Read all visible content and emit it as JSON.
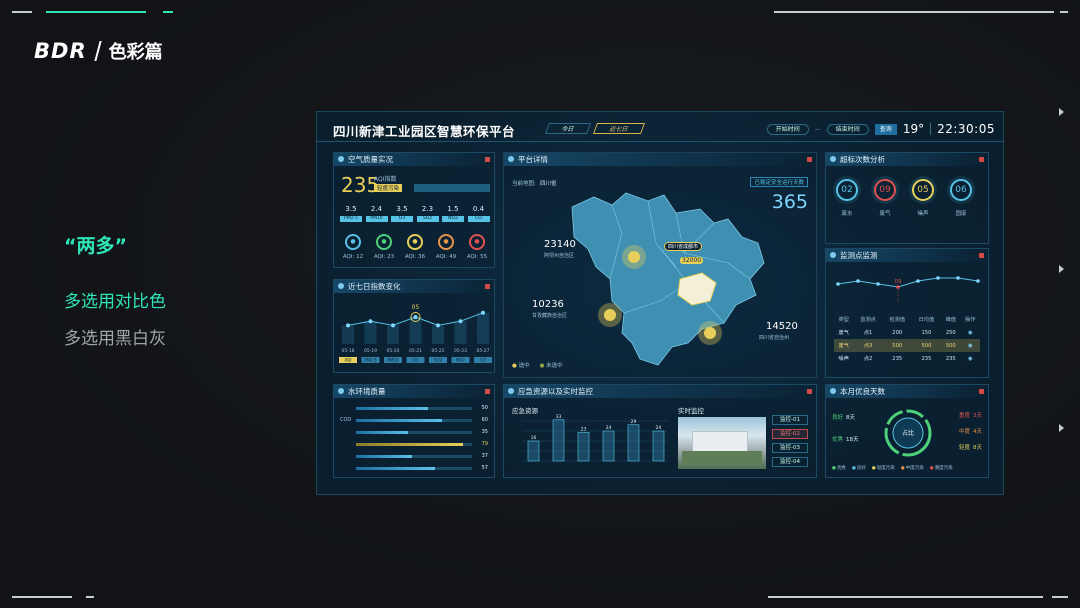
{
  "brand": {
    "logo": "BDR",
    "subtitle": "色彩篇"
  },
  "slide": {
    "quote": "“两多”",
    "point1": "多选用对比色",
    "point2": "多选用黑白灰"
  },
  "dashboard": {
    "title": "四川新津工业园区智慧环保平台",
    "tabs": [
      "今日",
      "近七日"
    ],
    "start_label": "开始时间",
    "end_label": "结束时间",
    "query_label": "查询",
    "temperature": "19°",
    "time": "22:30:05",
    "air": {
      "title": "空气质量实况",
      "aqi": "235",
      "aqi_label": "AQI指数",
      "level": "轻度污染",
      "readings": [
        {
          "v": "3.5",
          "n": "PM2.5"
        },
        {
          "v": "2.4",
          "n": "PM10"
        },
        {
          "v": "3.5",
          "n": "O3"
        },
        {
          "v": "2.3",
          "n": "SO2"
        },
        {
          "v": "1.5",
          "n": "NO2"
        },
        {
          "v": "0.4",
          "n": "CO"
        }
      ],
      "icons": [
        {
          "c": "#5bc0ea",
          "a": "AQI: 12"
        },
        {
          "c": "#4fd07a",
          "a": "AQI: 23"
        },
        {
          "c": "#e8cf5a",
          "a": "AQI: 36"
        },
        {
          "c": "#e8924a",
          "a": "AQI: 49"
        },
        {
          "c": "#e05252",
          "a": "AQI: 55"
        }
      ]
    },
    "seven": {
      "title": "近七日指数变化",
      "peak": "05",
      "dates": [
        "05-18",
        "05-19",
        "05-20",
        "05-21",
        "05-22",
        "05-23",
        "05-27"
      ],
      "values": [
        3,
        4,
        3,
        5,
        3,
        4,
        6
      ],
      "tags": [
        "AQI",
        "PM2.5",
        "PM10",
        "O3",
        "SO2",
        "NO2",
        "CO"
      ]
    },
    "water": {
      "title": "水环境质量",
      "rows": [
        {
          "l": "",
          "v": "50",
          "p": 0.62
        },
        {
          "l": "COD",
          "v": "60",
          "p": 0.74
        },
        {
          "l": "",
          "v": "35",
          "p": 0.45
        },
        {
          "l": "",
          "v": "79",
          "p": 0.92,
          "hl": true
        },
        {
          "l": "",
          "v": "37",
          "p": 0.48
        },
        {
          "l": "",
          "v": "57",
          "p": 0.68
        }
      ]
    },
    "map": {
      "title": "平台详情",
      "area_prefix": "当前地图:",
      "area": "四川省",
      "run_days_label": "已稳定安全运行天数",
      "run_days": "365",
      "labels": [
        {
          "v": "23140",
          "n": "阿坝州自治区"
        },
        {
          "v": "10236",
          "n": "甘孜藏族自治区"
        },
        {
          "v": "14520",
          "n": "四川省自治州"
        },
        {
          "v": "32000",
          "n": "四川省成都市"
        }
      ],
      "legend": [
        "选中",
        "未选中"
      ]
    },
    "emergency": {
      "title": "应急资源以及实时监控",
      "sub1": "应急资源",
      "sub2": "实时监控",
      "bars": [
        16,
        33,
        23,
        24,
        29,
        24
      ],
      "monitors": [
        "监控-01",
        "监控-02",
        "监控-03",
        "监控-04"
      ]
    },
    "exceed": {
      "title": "超标次数分析",
      "items": [
        {
          "v": "02",
          "n": "废水",
          "c": "#56c3e6"
        },
        {
          "v": "09",
          "n": "废气",
          "c": "#e05252"
        },
        {
          "v": "05",
          "n": "噪声",
          "c": "#e8cf5a"
        },
        {
          "v": "06",
          "n": "固废",
          "c": "#56c3e6"
        }
      ]
    },
    "monitor": {
      "title": "监测点监测",
      "peak": "09",
      "values": [
        5,
        6,
        5,
        4,
        6,
        7,
        7,
        6
      ],
      "cols": [
        "类型",
        "监测点",
        "检测值",
        "日均值",
        "峰值",
        "操作"
      ],
      "rows": [
        [
          "废气",
          "点1",
          "200",
          "150",
          "250"
        ],
        [
          "废气",
          "点3",
          "500",
          "500",
          "500"
        ],
        [
          "噪声",
          "点2",
          "235",
          "235",
          "235"
        ]
      ]
    },
    "good": {
      "title": "本月优良天数",
      "center": "占比",
      "left": [
        {
          "l": "良好",
          "v": "8天"
        },
        {
          "l": "优秀",
          "v": "18天"
        }
      ],
      "right": [
        {
          "l": "重度",
          "v": "3天"
        },
        {
          "l": "中度",
          "v": "4天"
        },
        {
          "l": "轻度",
          "v": "8天"
        }
      ],
      "legend": [
        {
          "l": "优秀",
          "c": "#4fd07a"
        },
        {
          "l": "良好",
          "c": "#56c3e6"
        },
        {
          "l": "轻度污染",
          "c": "#e8cf5a"
        },
        {
          "l": "中度污染",
          "c": "#e8924a"
        },
        {
          "l": "重度污染",
          "c": "#e05252"
        }
      ]
    }
  }
}
